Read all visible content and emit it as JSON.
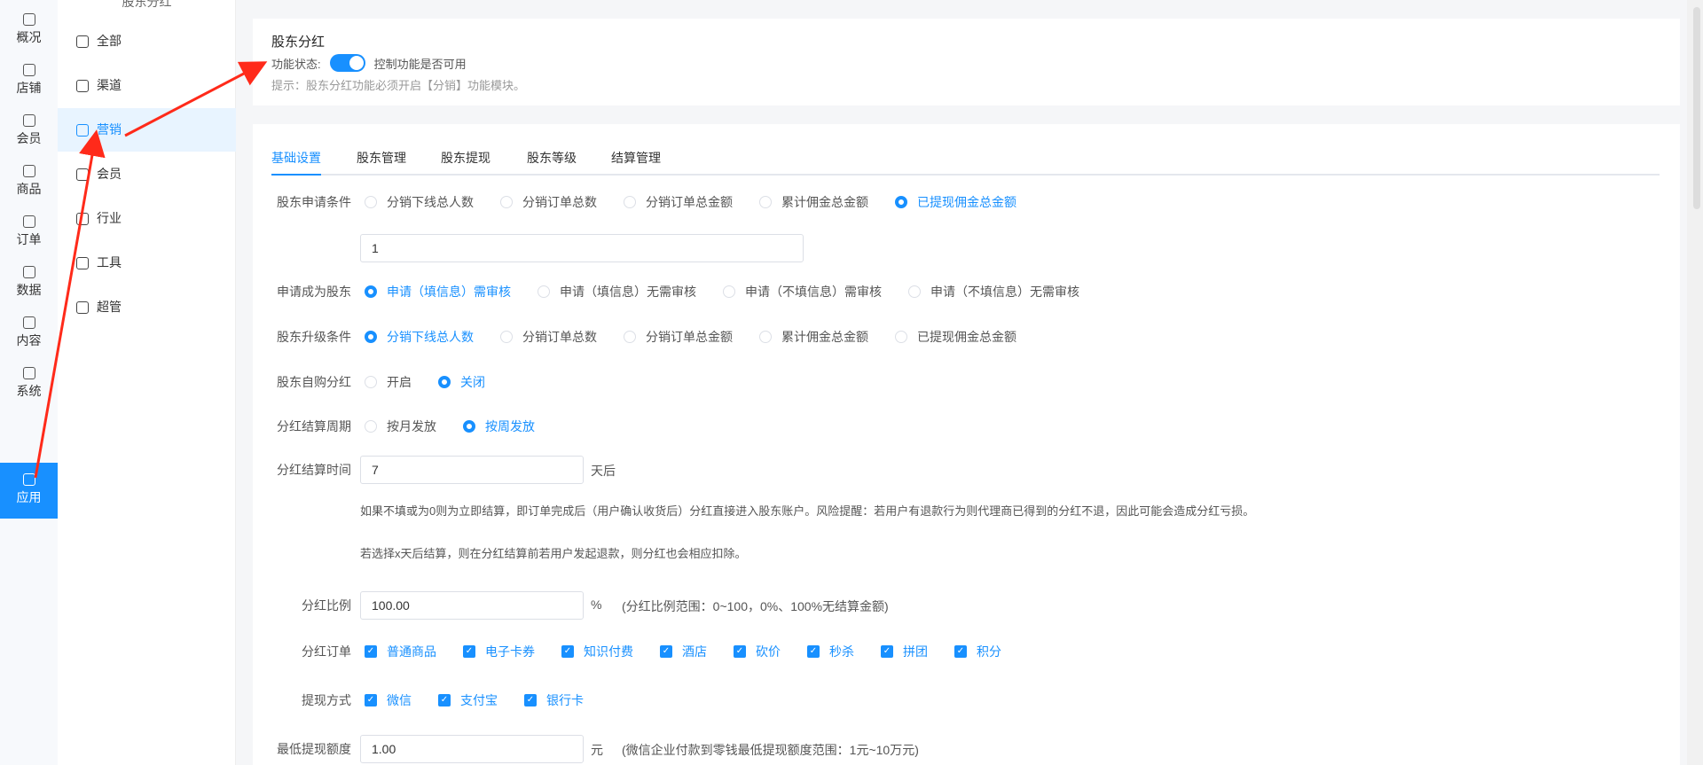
{
  "rail": [
    {
      "label": "概况",
      "icon": "dashboard-icon"
    },
    {
      "label": "店铺",
      "icon": "store-icon"
    },
    {
      "label": "会员",
      "icon": "user-icon"
    },
    {
      "label": "商品",
      "icon": "box-icon"
    },
    {
      "label": "订单",
      "icon": "clipboard-icon"
    },
    {
      "label": "数据",
      "icon": "pie-chart-icon"
    },
    {
      "label": "内容",
      "icon": "folder-icon"
    },
    {
      "label": "系统",
      "icon": "gear-icon"
    },
    {
      "label": "应用",
      "icon": "cube-icon",
      "active": true
    }
  ],
  "sub": {
    "title": "股东分红",
    "items": [
      {
        "label": "全部",
        "icon": "cube-icon"
      },
      {
        "label": "渠道",
        "icon": "channel-icon"
      },
      {
        "label": "营销",
        "icon": "monitor-chart-icon",
        "active": true
      },
      {
        "label": "会员",
        "icon": "user-icon"
      },
      {
        "label": "行业",
        "icon": "briefcase-icon"
      },
      {
        "label": "工具",
        "icon": "wrench-icon"
      },
      {
        "label": "超管",
        "icon": "admin-user-icon"
      }
    ]
  },
  "header": {
    "title": "股东分红",
    "status_label": "功能状态:",
    "toggle_on": true,
    "toggle_text": "控制功能是否可用",
    "hint": "提示：股东分红功能必须开启【分销】功能模块。"
  },
  "tabs": [
    {
      "label": "基础设置",
      "active": true
    },
    {
      "label": "股东管理"
    },
    {
      "label": "股东提现"
    },
    {
      "label": "股东等级"
    },
    {
      "label": "结算管理"
    }
  ],
  "form": {
    "apply_condition": {
      "label": "股东申请条件",
      "options": [
        "分销下线总人数",
        "分销订单总数",
        "分销订单总金额",
        "累计佣金总金额",
        "已提现佣金总金额"
      ],
      "selected": 4,
      "value": "1"
    },
    "become": {
      "label": "申请成为股东",
      "options": [
        "申请（填信息）需审核",
        "申请（填信息）无需审核",
        "申请（不填信息）需审核",
        "申请（不填信息）无需审核"
      ],
      "selected": 0
    },
    "upgrade": {
      "label": "股东升级条件",
      "options": [
        "分销下线总人数",
        "分销订单总数",
        "分销订单总金额",
        "累计佣金总金额",
        "已提现佣金总金额"
      ],
      "selected": 0
    },
    "self_buy": {
      "label": "股东自购分红",
      "options": [
        "开启",
        "关闭"
      ],
      "selected": 1
    },
    "cycle": {
      "label": "分红结算周期",
      "options": [
        "按月发放",
        "按周发放"
      ],
      "selected": 1
    },
    "settle_time": {
      "label": "分红结算时间",
      "value": "7",
      "unit": "天后",
      "note1": "如果不填或为0则为立即结算，即订单完成后（用户确认收货后）分红直接进入股东账户。风险提醒：若用户有退款行为则代理商已得到的分红不退，因此可能会造成分红亏损。",
      "note2": "若选择x天后结算，则在分红结算前若用户发起退款，则分红也会相应扣除。"
    },
    "ratio": {
      "label": "分红比例",
      "value": "100.00",
      "unit": "%",
      "note": "(分红比例范围：0~100，0%、100%无结算金额)"
    },
    "orders": {
      "label": "分红订单",
      "options": [
        "普通商品",
        "电子卡券",
        "知识付费",
        "酒店",
        "砍价",
        "秒杀",
        "拼团",
        "积分"
      ]
    },
    "withdraw": {
      "label": "提现方式",
      "options": [
        "微信",
        "支付宝",
        "银行卡"
      ]
    },
    "min_withdraw": {
      "label": "最低提现额度",
      "value": "1.00",
      "unit": "元",
      "note": "(微信企业付款到零钱最低提现额度范围：1元~10万元)"
    }
  },
  "colors": {
    "accent": "#1890ff",
    "annotation": "#ff2a1a"
  }
}
